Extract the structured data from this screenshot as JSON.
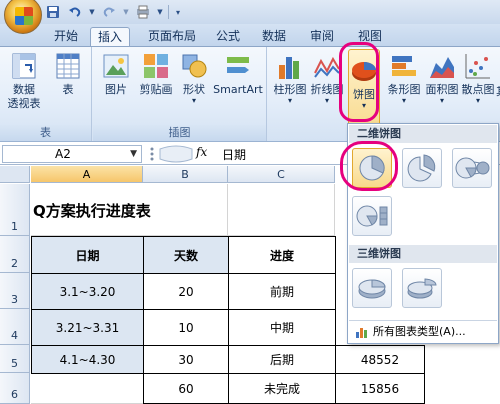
{
  "title_bar": {
    "qat_icons": [
      "save-icon",
      "undo-icon",
      "redo-icon",
      "customize-icon"
    ]
  },
  "tabs": [
    {
      "label": "开始",
      "active": false
    },
    {
      "label": "插入",
      "active": true
    },
    {
      "label": "页面布局",
      "active": false
    },
    {
      "label": "公式",
      "active": false
    },
    {
      "label": "数据",
      "active": false
    },
    {
      "label": "审阅",
      "active": false
    },
    {
      "label": "视图",
      "active": false
    }
  ],
  "ribbon": {
    "tables_group": {
      "label": "表",
      "pivot_label_1": "数据",
      "pivot_label_2": "透视表",
      "table_label": "表"
    },
    "illustrations_group": {
      "label": "插图",
      "picture_label": "图片",
      "clipart_label": "剪贴画",
      "shapes_label": "形状",
      "smartart_label": "SmartArt"
    },
    "charts_group": {
      "column_label": "柱形图",
      "line_label": "折线图",
      "pie_label": "饼图",
      "bar_label": "条形图",
      "area_label": "面积图",
      "scatter_label": "散点图",
      "other_label": "其"
    }
  },
  "formula_bar": {
    "name_box": "A2",
    "fx": "fx",
    "value": "日期"
  },
  "sheet": {
    "columns": [
      "A",
      "B",
      "C"
    ],
    "rows": [
      "1",
      "2",
      "3",
      "4",
      "5",
      "6"
    ],
    "title": "Q方案执行进度表",
    "headers": {
      "date": "日期",
      "days": "天数",
      "progress": "进度"
    },
    "data_rows": [
      {
        "date": "3.1~3.20",
        "days": "20",
        "progress": "前期",
        "extra": ""
      },
      {
        "date": "3.21~3.31",
        "days": "10",
        "progress": "中期",
        "extra": ""
      },
      {
        "date": "4.1~4.30",
        "days": "30",
        "progress": "后期",
        "extra": "48552"
      },
      {
        "date": "",
        "days": "60",
        "progress": "未完成",
        "extra": "15856"
      }
    ]
  },
  "pie_gallery": {
    "header_2d": "二维饼图",
    "header_3d": "三维饼图",
    "footer": "所有图表类型(A)..."
  }
}
